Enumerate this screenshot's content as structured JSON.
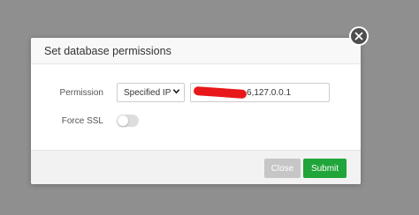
{
  "dialog": {
    "title": "Set database permissions"
  },
  "form": {
    "permission_label": "Permission",
    "permission_select": "Specified IP",
    "ip_value_visible": "6,127.0.0.1",
    "force_ssl_label": "Force SSL",
    "force_ssl_enabled": false
  },
  "buttons": {
    "close_label": "Close",
    "submit_label": "Submit"
  },
  "icons": {
    "close": "close-icon",
    "dropdown": "chevron-down-icon"
  },
  "colors": {
    "submit_green": "#20a53a",
    "close_disabled_gray": "#c6c6c6",
    "redaction_red": "#e8181a"
  }
}
